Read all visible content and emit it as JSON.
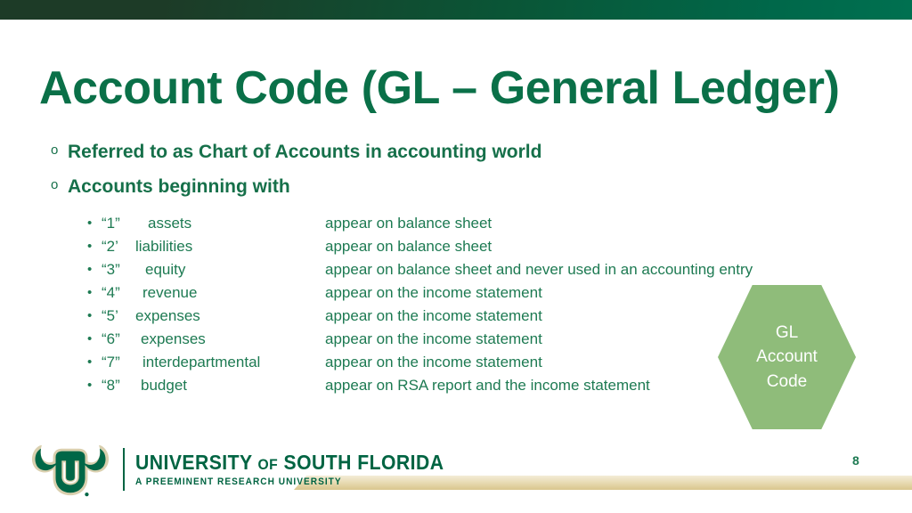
{
  "slide": {
    "title": "Account Code (GL – General Ledger)",
    "page_number": "8",
    "accent_green": "#0a7048",
    "body_green": "#1d7a52",
    "band_dark_green": "#1d3b27",
    "band_light_green": "#00684a",
    "hex_green": "#8fbc7a",
    "gold_band": "#e9dcb6"
  },
  "bullets": [
    {
      "marker": "o",
      "text": "Referred to as Chart of Accounts in accounting world"
    },
    {
      "marker": "o",
      "text": "Accounts beginning with"
    }
  ],
  "account_rows": [
    {
      "dot": "•",
      "code": "“1”",
      "term": "assets",
      "desc": "appear on balance sheet"
    },
    {
      "dot": "•",
      "code": "“2’",
      "term": "liabilities",
      "desc": "appear on balance sheet"
    },
    {
      "dot": "•",
      "code": "“3”",
      "term": "equity",
      "desc": "appear on balance sheet and never used in an accounting entry"
    },
    {
      "dot": "•",
      "code": "“4”",
      "term": "revenue",
      "desc": "appear on the income statement"
    },
    {
      "dot": "•",
      "code": "“5’",
      "term": "expenses",
      "desc": "appear on the income statement"
    },
    {
      "dot": "•",
      "code": "“6”",
      "term": "expenses",
      "desc": "appear on the income statement"
    },
    {
      "dot": "•",
      "code": "“7”",
      "term": "interdepartmental",
      "desc": "appear on the income statement"
    },
    {
      "dot": "•",
      "code": "“8”",
      "term": "budget",
      "desc": "appear on RSA report and the income statement"
    }
  ],
  "hexagon": {
    "label": "GL\nAccount\nCode"
  },
  "logo": {
    "name_main": "UNIVERSITY",
    "name_of": "OF",
    "name_rest": "SOUTH FLORIDA",
    "tagline": "A PREEMINENT RESEARCH UNIVERSITY"
  }
}
